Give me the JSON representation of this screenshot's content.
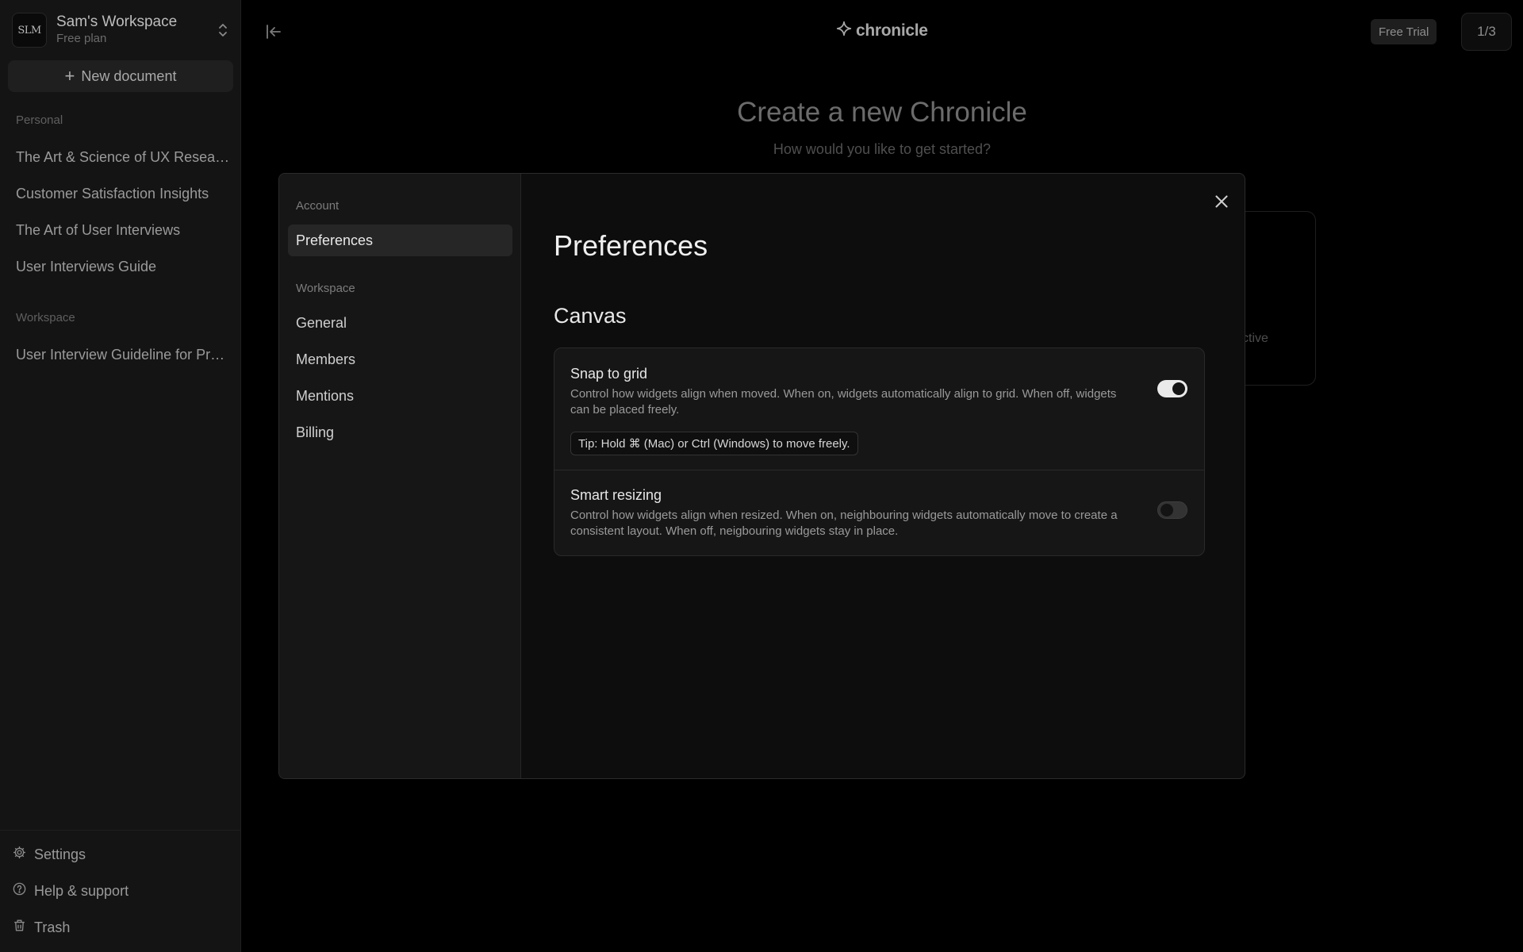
{
  "workspace": {
    "avatar": "SLM",
    "name": "Sam's Workspace",
    "plan": "Free plan"
  },
  "sidebar": {
    "new_document": "New document",
    "personal_label": "Personal",
    "personal_items": [
      "The Art & Science of UX Research",
      "Customer Satisfaction Insights",
      "The Art of User Interviews",
      "User Interviews Guide"
    ],
    "workspace_label": "Workspace",
    "workspace_items": [
      "User Interview Guideline for Product Teams"
    ],
    "footer": {
      "settings": "Settings",
      "help": "Help & support",
      "trash": "Trash"
    }
  },
  "header": {
    "brand": "chronicle",
    "free_trial": "Free Trial",
    "page_counter": "1/3"
  },
  "hero": {
    "title": "Create a new Chronicle",
    "subtitle": "How would you like to get started?",
    "card_fragment": "ctive"
  },
  "modal": {
    "nav": {
      "account_label": "Account",
      "preferences": "Preferences",
      "workspace_label": "Workspace",
      "general": "General",
      "members": "Members",
      "mentions": "Mentions",
      "billing": "Billing"
    },
    "title": "Preferences",
    "section": "Canvas",
    "snap": {
      "title": "Snap to grid",
      "description": "Control how widgets align when moved. When on, widgets automatically align to grid. When off, widgets can be placed freely.",
      "tip": "Tip: Hold ⌘ (Mac) or Ctrl (Windows) to move freely.",
      "enabled": true
    },
    "smart": {
      "title": "Smart resizing",
      "description": "Control how widgets align when resized. When on, neighbouring widgets automatically move to create a consistent layout. When off, neigbouring widgets stay in place.",
      "enabled": false
    }
  }
}
